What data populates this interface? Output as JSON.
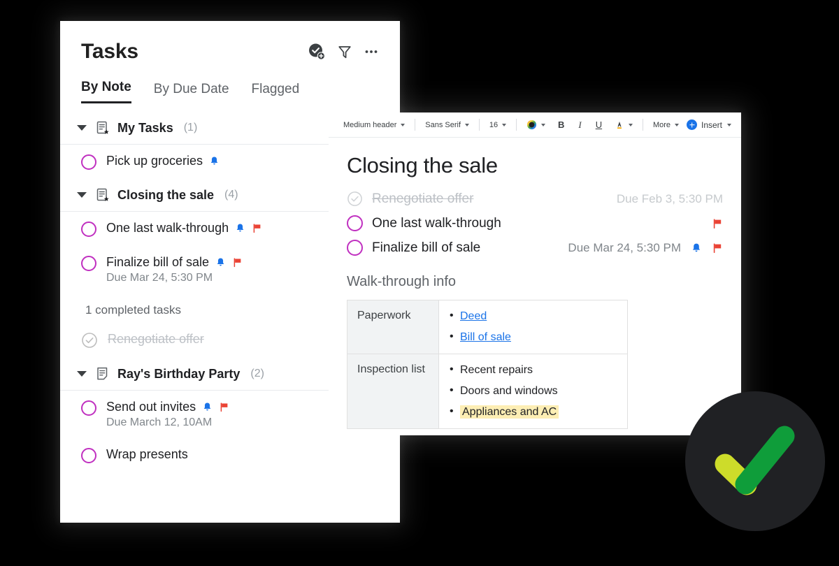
{
  "tasks_panel": {
    "title": "Tasks",
    "header_icons": [
      {
        "name": "add-task-icon",
        "label": "Add task"
      },
      {
        "name": "filter-icon",
        "label": "Filter"
      },
      {
        "name": "more-options-icon",
        "label": "More options"
      }
    ],
    "tabs": [
      {
        "label": "By Note",
        "active": true
      },
      {
        "label": "By Due Date",
        "active": false
      },
      {
        "label": "Flagged",
        "active": false
      }
    ],
    "groups": [
      {
        "name": "My Tasks",
        "count": "(1)",
        "icon": "note-starred-icon",
        "tasks": [
          {
            "title": "Pick up groceries",
            "due": "",
            "reminder": true,
            "flagged": false,
            "done": false
          }
        ]
      },
      {
        "name": "Closing the sale",
        "count": "(4)",
        "icon": "note-starred-icon",
        "tasks": [
          {
            "title": "One last walk-through",
            "due": "",
            "reminder": true,
            "flagged": true,
            "done": false
          },
          {
            "title": "Finalize bill of sale",
            "due": "Due Mar 24, 5:30 PM",
            "reminder": true,
            "flagged": true,
            "done": false
          }
        ],
        "completed_label": "1 completed tasks",
        "completed_tasks": [
          {
            "title": "Renegotiate offer",
            "due": "",
            "reminder": false,
            "flagged": false,
            "done": true
          }
        ]
      },
      {
        "name": "Ray's Birthday Party",
        "count": "(2)",
        "icon": "note-icon",
        "tasks": [
          {
            "title": "Send out invites",
            "due": "Due March 12, 10AM",
            "reminder": true,
            "flagged": true,
            "done": false
          },
          {
            "title": "Wrap presents",
            "due": "",
            "reminder": false,
            "flagged": false,
            "done": false
          }
        ]
      }
    ]
  },
  "note_panel": {
    "toolbar": {
      "style_select": "Medium header",
      "font_select": "Sans Serif",
      "size_select": "16",
      "color_label": "Text color",
      "bold_label": "B",
      "italic_label": "I",
      "underline_label": "U",
      "highlight_label": "Highlight",
      "more_label": "More",
      "insert_label": "Insert"
    },
    "note_title": "Closing the sale",
    "note_tasks": [
      {
        "title": "Renegotiate offer",
        "due": "Due Feb 3, 5:30 PM",
        "reminder": false,
        "flagged": false,
        "done": true
      },
      {
        "title": "One last walk-through",
        "due": "",
        "reminder": false,
        "flagged": true,
        "done": false
      },
      {
        "title": "Finalize bill of sale",
        "due": "Due Mar 24, 5:30 PM",
        "reminder": true,
        "flagged": true,
        "done": false
      }
    ],
    "section_title": "Walk-through info",
    "table": {
      "rows": [
        {
          "key": "Paperwork",
          "items": [
            {
              "text": "Deed",
              "link": true,
              "highlight": false
            },
            {
              "text": "Bill of sale",
              "link": true,
              "highlight": false
            }
          ]
        },
        {
          "key": "Inspection list",
          "items": [
            {
              "text": "Recent repairs",
              "link": false,
              "highlight": false
            },
            {
              "text": "Doors and windows",
              "link": false,
              "highlight": false
            },
            {
              "text": "Appliances and AC",
              "link": false,
              "highlight": true
            }
          ]
        }
      ]
    }
  },
  "badge": {
    "name": "checkmark-badge",
    "circle_color": "#202124",
    "check_color_primary": "#0f9d3a",
    "check_color_secondary": "#cddc2a"
  },
  "colors": {
    "checkbox_open": "#c030c0",
    "checkbox_done": "#bdbdbd",
    "flag": "#ea4335",
    "reminder": "#1a73e8",
    "link": "#1a73e8",
    "highlight": "#fdeeb4",
    "background": "#000000"
  }
}
